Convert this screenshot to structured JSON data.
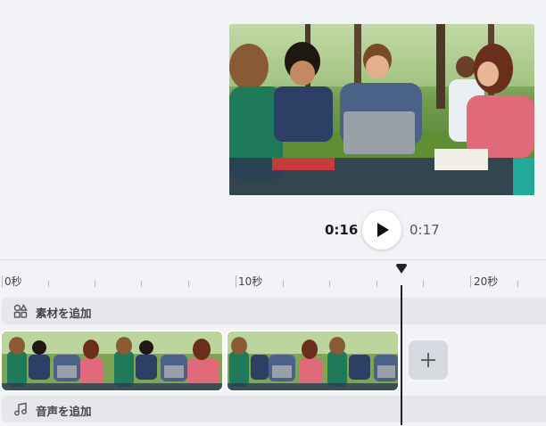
{
  "player": {
    "current_time": "0:16",
    "total_time": "0:17",
    "play_icon": "play-icon"
  },
  "timeline": {
    "ruler_labels": [
      "0秒",
      "10秒",
      "20秒"
    ],
    "add_media_label": "素材を追加",
    "add_media_icon": "shapes-icon",
    "add_audio_label": "音声を追加",
    "add_audio_icon": "music-note-icon",
    "add_clip_icon": "plus-icon"
  },
  "colors": {
    "background": "#f2f3f6",
    "track_bg": "#e6e7eb",
    "playhead": "#222222"
  }
}
